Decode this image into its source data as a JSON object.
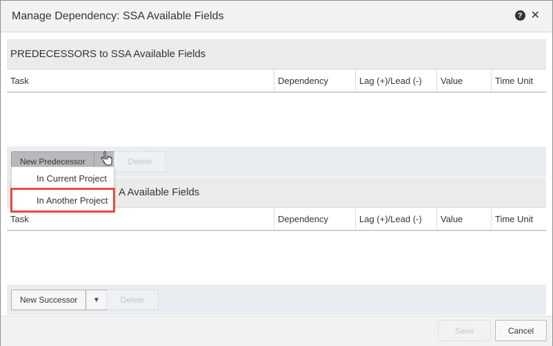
{
  "dialog": {
    "title": "Manage Dependency: SSA Available Fields",
    "help_icon": "help-icon",
    "help_glyph": "?",
    "close_icon": "close-icon",
    "close_glyph": "✕"
  },
  "predecessors": {
    "header": "PREDECESSORS to SSA Available Fields",
    "columns": [
      "Task",
      "Dependency",
      "Lag (+)/Lead (-)",
      "Value",
      "Time Unit"
    ],
    "new_button": "New Predecessor",
    "delete_button": "Delete"
  },
  "successors": {
    "header": "A Available Fields",
    "columns": [
      "Task",
      "Dependency",
      "Lag (+)/Lead (-)",
      "Value",
      "Time Unit"
    ],
    "new_button": "New Successor",
    "delete_button": "Delete"
  },
  "dropdown": {
    "items": [
      "In Current Project",
      "In Another Project"
    ],
    "highlighted_index": 1
  },
  "footer": {
    "save_label": "Save",
    "cancel_label": "Cancel"
  },
  "colors": {
    "highlight": "#e74c3c",
    "toolbar_bg": "#e9edf2"
  }
}
